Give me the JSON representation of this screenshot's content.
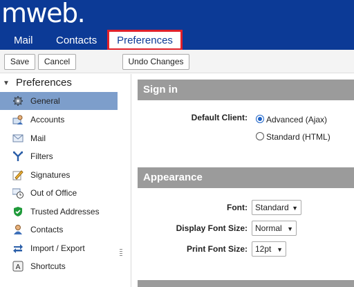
{
  "app": {
    "logo": "mweb."
  },
  "nav": {
    "tabs": [
      {
        "label": "Mail"
      },
      {
        "label": "Contacts"
      },
      {
        "label": "Preferences"
      }
    ]
  },
  "toolbar": {
    "save_label": "Save",
    "cancel_label": "Cancel",
    "undo_label": "Undo Changes"
  },
  "sidebar": {
    "title": "Preferences",
    "items": [
      {
        "label": "General",
        "icon": "gear-icon",
        "selected": true
      },
      {
        "label": "Accounts",
        "icon": "accounts-icon"
      },
      {
        "label": "Mail",
        "icon": "envelope-icon"
      },
      {
        "label": "Filters",
        "icon": "filter-icon"
      },
      {
        "label": "Signatures",
        "icon": "signature-icon"
      },
      {
        "label": "Out of Office",
        "icon": "out-of-office-icon"
      },
      {
        "label": "Trusted Addresses",
        "icon": "shield-check-icon"
      },
      {
        "label": "Contacts",
        "icon": "contacts-icon"
      },
      {
        "label": "Import / Export",
        "icon": "import-export-icon"
      },
      {
        "label": "Shortcuts",
        "icon": "shortcut-key-icon"
      }
    ]
  },
  "content": {
    "signin": {
      "title": "Sign in",
      "default_client_label": "Default Client:",
      "options": [
        {
          "label": "Advanced (Ajax)",
          "checked": true
        },
        {
          "label": "Standard (HTML)",
          "checked": false
        }
      ]
    },
    "appearance": {
      "title": "Appearance",
      "font_label": "Font:",
      "font_value": "Standard",
      "display_font_size_label": "Display Font Size:",
      "display_font_size_value": "Normal",
      "print_font_size_label": "Print Font Size:",
      "print_font_size_value": "12pt"
    }
  },
  "colors": {
    "header": "#0c3a96",
    "selected": "#7d9ecb",
    "highlight_border": "#e0202a",
    "section": "#9b9b9b"
  }
}
